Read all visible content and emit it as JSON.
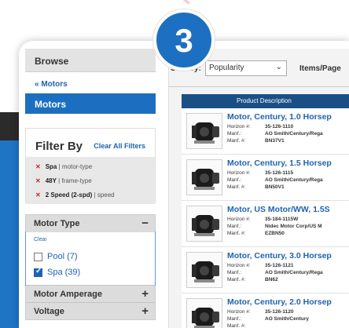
{
  "step_badge": "3",
  "sidebar": {
    "browse_title": "Browse",
    "back_link": "« Motors",
    "active_category": "Motors",
    "filter_title": "Filter By",
    "clear_all": "Clear All Filters",
    "applied_filters": [
      {
        "value": "Spa",
        "type": "| motor-type"
      },
      {
        "value": "48Y",
        "type": "| frame-type"
      },
      {
        "value": "2 Speed (2-spd)",
        "type": "| speed"
      }
    ],
    "motor_type": {
      "title": "Motor Type",
      "toggle": "−",
      "clear": "Clear",
      "options": [
        {
          "label": "Pool (7)",
          "checked": false
        },
        {
          "label": "Spa (39)",
          "checked": true
        }
      ]
    },
    "collapsed_sections": [
      {
        "title": "Motor Amperage",
        "toggle": "+"
      },
      {
        "title": "Voltage",
        "toggle": "+"
      }
    ]
  },
  "results": {
    "sort_label": "Sort By:",
    "sort_value": "Popularity",
    "items_label": "Items/Page",
    "column_header": "Product Description",
    "meta_labels": {
      "horizon": "Horizon #:",
      "manf": "Manf.:",
      "manf_no": "Manf. #:"
    },
    "products": [
      {
        "title": "Motor, Century, 1.0 Horsep",
        "horizon": "35-126-1110",
        "manf": "AO Smith/Century/Rega",
        "manf_no": "BN37V1"
      },
      {
        "title": "Motor, Century, 1.5 Horsep",
        "horizon": "35-126-1115",
        "manf": "AO Smith/Century/Rega",
        "manf_no": "BN50V1"
      },
      {
        "title": "Motor, US Motor/WW, 1.5S",
        "horizon": "35-184-1115W",
        "manf": "Nidec Motor Corp/US M",
        "manf_no": "EZBN50"
      },
      {
        "title": "Motor, Century, 3.0 Horsep",
        "horizon": "35-126-1121",
        "manf": "AO Smith/Century/Rega",
        "manf_no": "BN62"
      },
      {
        "title": "Motor, Century, 2.0 Horsep",
        "horizon": "35-126-1120",
        "manf": "AO Smith/Century",
        "manf_no": ""
      }
    ]
  },
  "colors": {
    "accent": "#1d70c1",
    "header_navy": "#1a4f85",
    "link": "#1e63b2",
    "remove_x": "#c0272d"
  }
}
